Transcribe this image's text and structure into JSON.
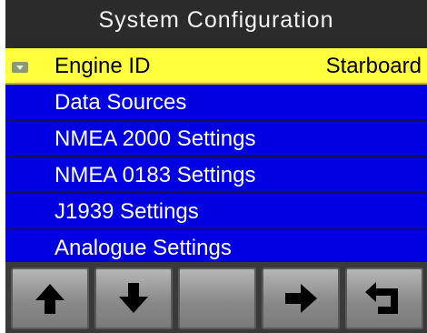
{
  "title": "System Configuration",
  "menu": {
    "items": [
      {
        "label": "Engine ID",
        "value": "Starboard",
        "selected": true
      },
      {
        "label": "Data Sources"
      },
      {
        "label": "NMEA 2000 Settings"
      },
      {
        "label": "NMEA 0183 Settings"
      },
      {
        "label": "J1939 Settings"
      },
      {
        "label": "Analogue Settings"
      }
    ]
  },
  "softkeys": [
    {
      "icon": "arrow-up-icon"
    },
    {
      "icon": "arrow-down-icon"
    },
    {
      "icon": ""
    },
    {
      "icon": "arrow-right-icon"
    },
    {
      "icon": "back-return-icon"
    }
  ],
  "colors": {
    "menu_background": "#0000e0",
    "selected_background": "#ffff3c",
    "title_background": "#2b2b2b"
  }
}
